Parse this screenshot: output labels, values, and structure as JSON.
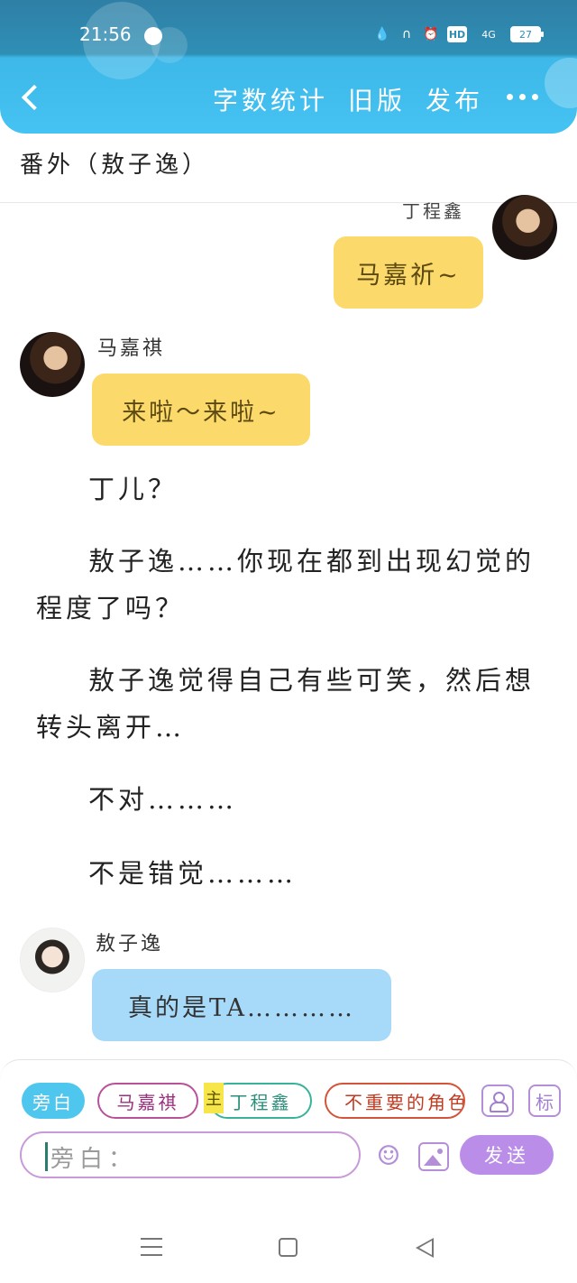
{
  "status_bar": {
    "time": "21:56",
    "hd_label": "HD",
    "signal_label": "4G",
    "battery_level": "27"
  },
  "app_bar": {
    "actions": [
      "字数统计",
      "旧版",
      "发布"
    ]
  },
  "chapter": {
    "title": "番外（敖子逸）"
  },
  "chat": {
    "msg1": {
      "speaker": "丁程鑫",
      "text": "马嘉祈~"
    },
    "msg2": {
      "speaker": "马嘉祺",
      "text": "来啦～来啦~"
    },
    "paragraphs": [
      "丁儿？",
      "敖子逸……你现在都到出现幻觉的程度了吗？",
      "敖子逸觉得自己有些可笑，然后想转头离开…",
      "不对………",
      "不是错觉………"
    ],
    "msg3": {
      "speaker": "敖子逸",
      "text": "真的是TA…………"
    }
  },
  "roles": {
    "narration": "旁白",
    "ma": "马嘉祺",
    "main_tag": "主",
    "ding": "丁程鑫",
    "unimportant": "不重要的角色"
  },
  "tools": {
    "mark_label": "标"
  },
  "input": {
    "placeholder": "旁白：",
    "send_label": "发送"
  },
  "colors": {
    "accent": "#45c3f2",
    "send": "#b98de8",
    "bubble_yellow": "#fbd96a",
    "bubble_blue": "#a7daf9"
  }
}
